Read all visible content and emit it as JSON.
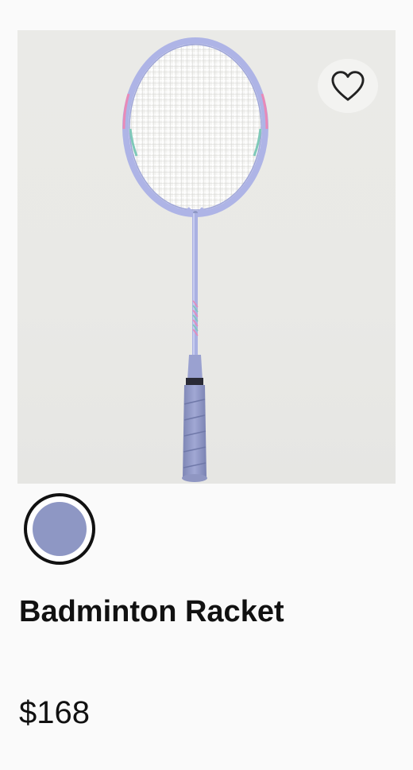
{
  "product": {
    "title": "Badminton Racket",
    "price": "$168",
    "image_alt": "Badminton racket with lavender frame",
    "favorite_icon": "heart-outline-icon"
  },
  "colors": {
    "swatches": [
      {
        "name": "lavender-blue",
        "color": "#8e97c4",
        "selected": true
      }
    ],
    "racket_frame": "#aeb4e6",
    "grip": "#8f96c2"
  }
}
